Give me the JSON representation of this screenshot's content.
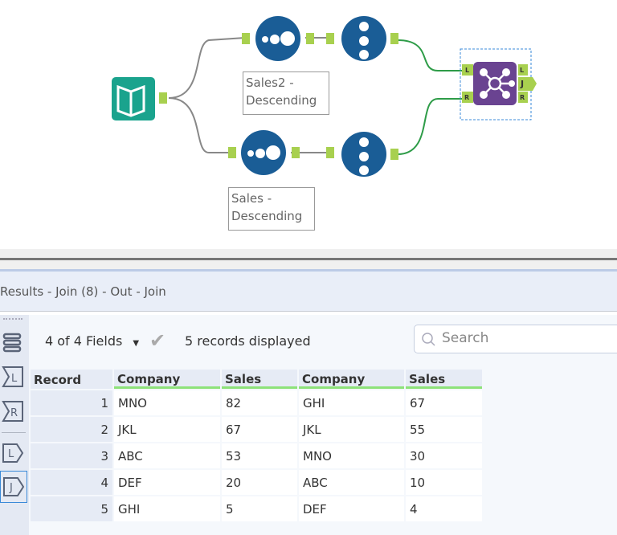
{
  "workflow": {
    "annotations": [
      "Sales2 - Descending",
      "Sales - Descending"
    ],
    "join_labels": {
      "left": "L",
      "right": "R",
      "join": "J"
    },
    "colors": {
      "tool_blue": "#1a5d96",
      "join_purple": "#6a4391",
      "input_teal": "#1aa38d",
      "connector": "#a8d04f",
      "line_active": "#2e9c48"
    }
  },
  "results": {
    "title": "Results - Join (8) - Out - Join",
    "fields_label": "4 of 4 Fields",
    "records_label": "5 records displayed",
    "search_placeholder": "Search",
    "side_icons": [
      "list-icon",
      "sum-left-icon",
      "sum-right-icon",
      "left-output-icon",
      "join-output-icon"
    ],
    "side_labels": {
      "l": "L",
      "r": "R",
      "j": "J"
    },
    "columns": [
      "Record",
      "Company",
      "Sales",
      "Company",
      "Sales"
    ],
    "rows": [
      [
        "1",
        "MNO",
        "82",
        "GHI",
        "67"
      ],
      [
        "2",
        "JKL",
        "67",
        "JKL",
        "55"
      ],
      [
        "3",
        "ABC",
        "53",
        "MNO",
        "30"
      ],
      [
        "4",
        "DEF",
        "20",
        "ABC",
        "10"
      ],
      [
        "5",
        "GHI",
        "5",
        "DEF",
        "4"
      ]
    ]
  }
}
